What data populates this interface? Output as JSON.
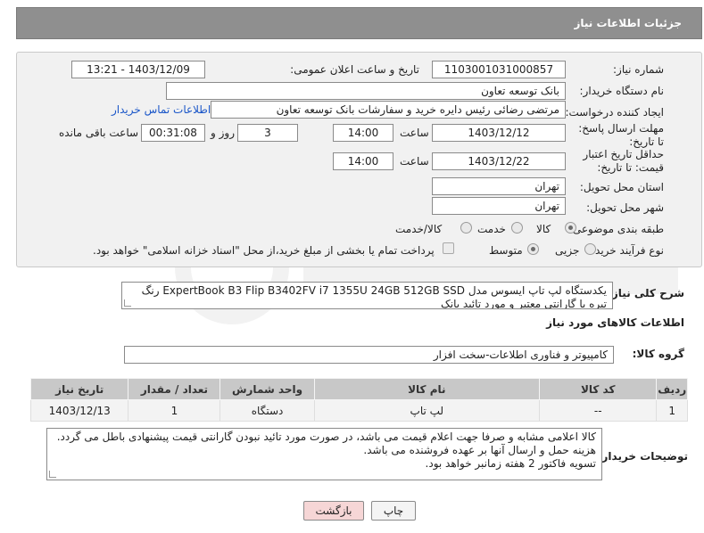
{
  "header": {
    "title": "جزئیات اطلاعات نیاز"
  },
  "form": {
    "need_number_label": "شماره نیاز:",
    "need_number": "1103001031000857",
    "announce_label": "تاریخ و ساعت اعلان عمومی:",
    "announce_value": "1403/12/09 - 13:21",
    "buyer_org_label": "نام دستگاه خریدار:",
    "buyer_org": "بانک توسعه تعاون",
    "requester_label": "ایجاد کننده درخواست:",
    "requester": "مرتضی رضائی رئیس دایره خرید و سفارشات بانک توسعه تعاون",
    "contact_link": "اطلاعات تماس خریدار",
    "deadline_label": "مهلت ارسال پاسخ: تا تاریخ:",
    "deadline_date": "1403/12/12",
    "time_label": "ساعت",
    "deadline_time": "14:00",
    "days_value": "3",
    "days_label": "روز و",
    "remaining_value": "00:31:08",
    "remaining_label": "ساعت باقی مانده",
    "validity_label": "حداقل تاریخ اعتبار قیمت: تا تاریخ:",
    "validity_date": "1403/12/22",
    "validity_time": "14:00",
    "province_label": "استان محل تحویل:",
    "province": "تهران",
    "city_label": "شهر محل تحویل:",
    "city": "تهران",
    "category_label": "طبقه بندی موضوعی:",
    "category_options": [
      "کالا",
      "خدمت",
      "کالا/خدمت"
    ],
    "process_label": "نوع فرآیند خرید :",
    "process_options": [
      "جزیی",
      "متوسط"
    ],
    "payment_note": "پرداخت تمام یا بخشی از مبلغ خرید،از محل \"اسناد خزانه اسلامی\" خواهد بود."
  },
  "summary": {
    "label": "شرح کلی نیاز:",
    "text": "یکدستگاه لپ تاپ ایسوس مدل ExpertBook B3 Flip B3402FV i7 1355U 24GB 512GB SSD رنگ تیره با گارانتی معتبر و مورد تائید بانک"
  },
  "goods": {
    "section_title": "اطلاعات کالاهای مورد نیاز",
    "group_label": "گروه کالا:",
    "group_value": "کامپیوتر و فناوری اطلاعات-سخت افزار",
    "columns": [
      "ردیف",
      "کد کالا",
      "نام کالا",
      "واحد شمارش",
      "تعداد / مقدار",
      "تاریخ نیاز"
    ],
    "rows": [
      {
        "row": "1",
        "code": "--",
        "name": "لپ تاپ",
        "unit": "دستگاه",
        "qty": "1",
        "date": "1403/12/13"
      }
    ]
  },
  "buyer_notes": {
    "label": "توضیحات خریدار:",
    "lines": [
      "کالا اعلامی مشابه و صرفا جهت اعلام قیمت می باشد، در صورت مورد تائید نبودن گارانتی قیمت پیشنهادی باطل می گردد.",
      "هزینه حمل و ارسال آنها بر عهده فروشنده می باشد.",
      "تسویه فاکتور 2 هفته زمانبر خواهد بود."
    ]
  },
  "buttons": {
    "print": "چاپ",
    "back": "بازگشت"
  },
  "colors": {
    "header_bg": "#8f8f8f",
    "link": "#1a56c8",
    "back_button_bg": "#f6d6d6"
  }
}
